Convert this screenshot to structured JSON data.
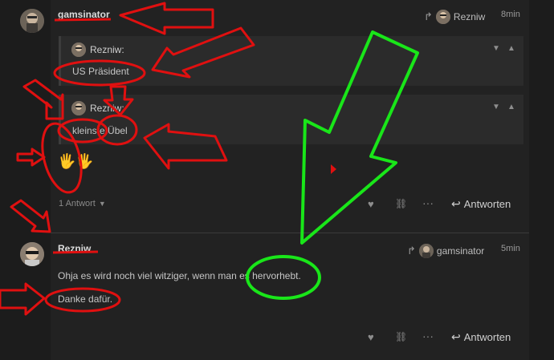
{
  "post1": {
    "author": "gamsinator",
    "reply_to": "Rezniw",
    "time": "8min",
    "quotes": [
      {
        "author": "Rezniw:",
        "text": "US Präsident"
      },
      {
        "author": "Rezniw:",
        "text": "kleinste Übel"
      }
    ],
    "emoji": "🖐🖐",
    "replies_count": "1 Antwort",
    "reply_label": "Antworten"
  },
  "post2": {
    "author": "Rezniw",
    "reply_to": "gamsinator",
    "time": "5min",
    "lines": [
      "Ohja es wird noch viel witziger, wenn man es hervorhebt.",
      "Danke dafür."
    ],
    "reply_label": "Antworten"
  },
  "annotation_colors": {
    "red": "#e01010",
    "green": "#19e619"
  }
}
